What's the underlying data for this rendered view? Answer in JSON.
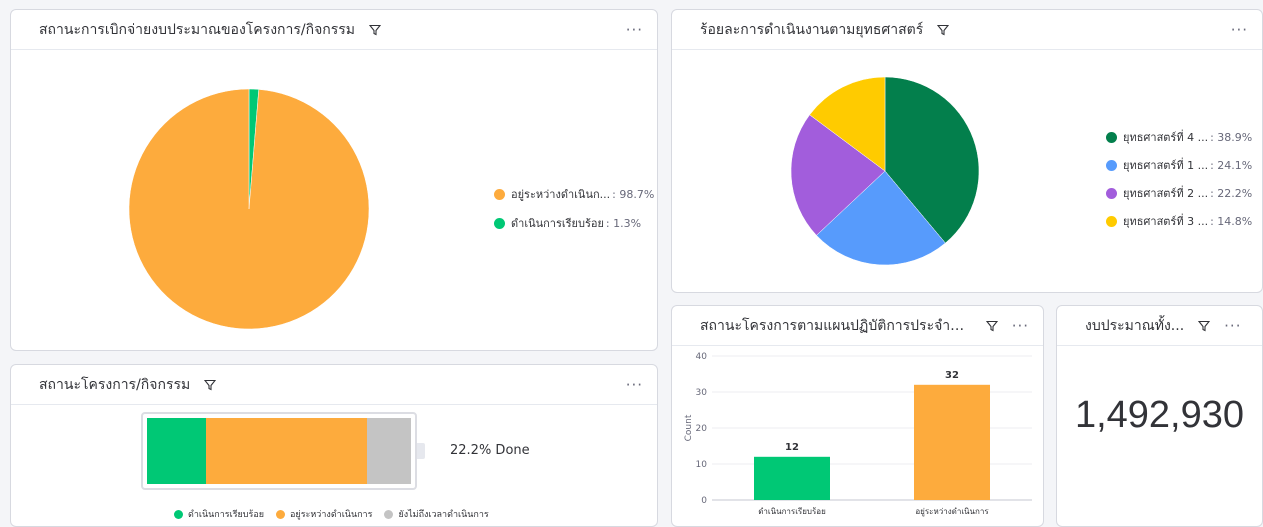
{
  "budget_card": {
    "title": "สถานะการเบิกจ่ายงบประมาณของโครงการ/กิจกรรม",
    "legend": [
      {
        "label": "อยู่ระหว่างดำเนินก...",
        "pct": ": 98.7%",
        "color": "#fdab3d"
      },
      {
        "label": "ดำเนินการเรียบร้อย",
        "pct": ": 1.3%",
        "color": "#00c875"
      }
    ]
  },
  "strategy_card": {
    "title": "ร้อยละการดำเนินงานตามยุทธศาสตร์",
    "legend": [
      {
        "label": "ยุทธศาสตร์ที่ 4 ...",
        "pct": ": 38.9%",
        "color": "#037f4c"
      },
      {
        "label": "ยุทธศาสตร์ที่ 1 ...",
        "pct": ": 24.1%",
        "color": "#579bfc"
      },
      {
        "label": "ยุทธศาสตร์ที่ 2 ...",
        "pct": ": 22.2%",
        "color": "#a25ddc"
      },
      {
        "label": "ยุทธศาสตร์ที่ 3 ...",
        "pct": ": 14.8%",
        "color": "#ffcb00"
      }
    ]
  },
  "status_card": {
    "title": "สถานะโครงการ/กิจกรรม",
    "done_text": "22.2% Done",
    "segments": [
      {
        "label": "ดำเนินการเรียบร้อย",
        "fraction": 0.222,
        "color": "#00c875"
      },
      {
        "label": "อยู่ระหว่างดำเนินการ",
        "fraction": 0.611,
        "color": "#fdab3d"
      },
      {
        "label": "ยังไม่ถึงเวลาดำเนินการ",
        "fraction": 0.167,
        "color": "#c4c4c4"
      }
    ]
  },
  "plan_card": {
    "title": "สถานะโครงการตามแผนปฏิบัติการประจำปี..."
  },
  "total_card": {
    "title": "งบประมาณทั้ง...",
    "value": "1,492,930"
  },
  "chart_data": [
    {
      "type": "pie",
      "title": "สถานะการเบิกจ่ายงบประมาณของโครงการ/กิจกรรม",
      "labels": [
        "อยู่ระหว่างดำเนินก...",
        "ดำเนินการเรียบร้อย"
      ],
      "values": [
        98.7,
        1.3
      ],
      "colors": [
        "#fdab3d",
        "#00c875"
      ],
      "legend": "right"
    },
    {
      "type": "pie",
      "title": "ร้อยละการดำเนินงานตามยุทธศาสตร์",
      "labels": [
        "ยุทธศาสตร์ที่ 4 ...",
        "ยุทธศาสตร์ที่ 1 ...",
        "ยุทธศาสตร์ที่ 2 ...",
        "ยุทธศาสตร์ที่ 3 ..."
      ],
      "values": [
        38.9,
        24.1,
        22.2,
        14.8
      ],
      "colors": [
        "#037f4c",
        "#579bfc",
        "#a25ddc",
        "#ffcb00"
      ],
      "legend": "right"
    },
    {
      "type": "bar",
      "title": "สถานะโครงการตามแผนปฏิบัติการประจำปี...",
      "categories": [
        "ดำเนินการเรียบร้อย",
        "อยู่ระหว่างดำเนินการ"
      ],
      "values": [
        12,
        32
      ],
      "colors": [
        "#00c875",
        "#fdab3d"
      ],
      "ylabel": "Count",
      "ylim": [
        0,
        40
      ],
      "yticks": [
        0,
        10,
        20,
        30,
        40
      ],
      "grid": true
    }
  ]
}
